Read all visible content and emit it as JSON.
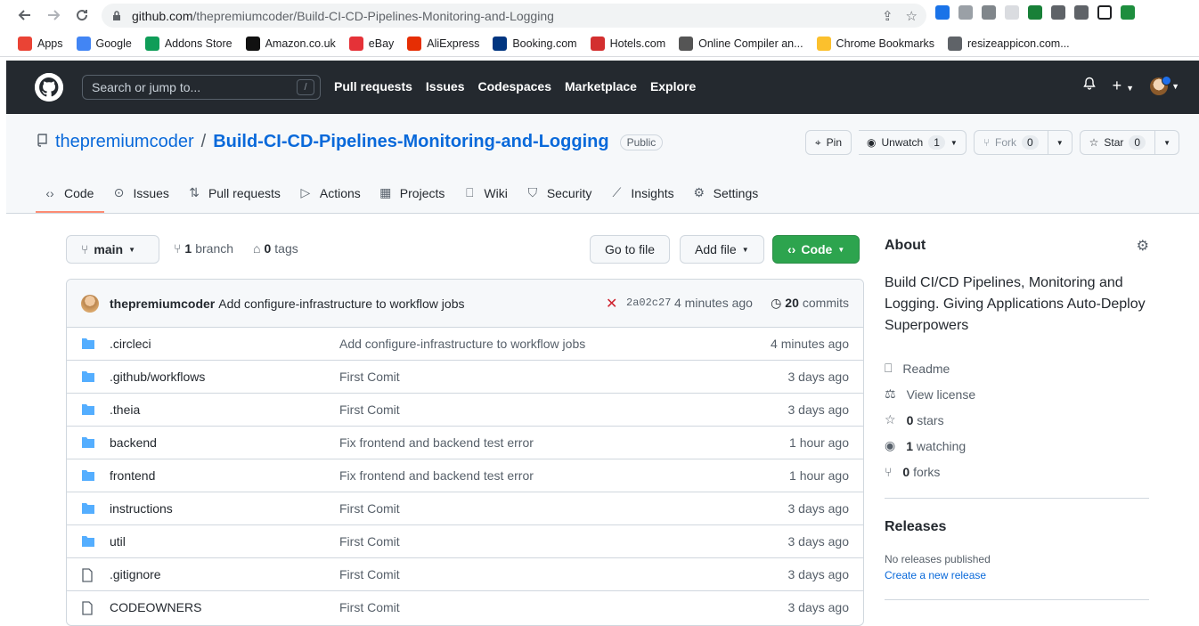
{
  "browser": {
    "url_host": "github.com",
    "url_path": "/thepremiumcoder/Build-CI-CD-Pipelines-Monitoring-and-Logging"
  },
  "bookmarks": [
    {
      "label": "Apps",
      "icon": "apps-grid-icon",
      "color": "#ea4335"
    },
    {
      "label": "Google",
      "icon": "google-icon",
      "color": "#4285f4"
    },
    {
      "label": "Addons Store",
      "icon": "addons-icon",
      "color": "#0f9d58"
    },
    {
      "label": "Amazon.co.uk",
      "icon": "amazon-icon",
      "color": "#111111"
    },
    {
      "label": "eBay",
      "icon": "ebay-icon",
      "color": "#e53238"
    },
    {
      "label": "AliExpress",
      "icon": "aliexpress-icon",
      "color": "#e62e04"
    },
    {
      "label": "Booking.com",
      "icon": "booking-icon",
      "color": "#003580"
    },
    {
      "label": "Hotels.com",
      "icon": "hotels-icon",
      "color": "#d32f2f"
    },
    {
      "label": "Online Compiler an...",
      "icon": "compiler-icon",
      "color": "#555555"
    },
    {
      "label": "Chrome Bookmarks",
      "icon": "folder-icon",
      "color": "#fbc02d"
    },
    {
      "label": "resizeappicon.com...",
      "icon": "globe-icon",
      "color": "#5f6368"
    }
  ],
  "header": {
    "search_placeholder": "Search or jump to...",
    "slash": "/",
    "nav": [
      "Pull requests",
      "Issues",
      "Codespaces",
      "Marketplace",
      "Explore"
    ]
  },
  "repo": {
    "owner": "thepremiumcoder",
    "sep": "/",
    "name": "Build-CI-CD-Pipelines-Monitoring-and-Logging",
    "visibility": "Public",
    "pin": "Pin",
    "unwatch": "Unwatch",
    "watch_count": "1",
    "fork": "Fork",
    "fork_count": "0",
    "star": "Star",
    "star_count": "0"
  },
  "tabs": [
    {
      "label": "Code",
      "icon": "code-icon",
      "glyph": "‹›"
    },
    {
      "label": "Issues",
      "icon": "issue-icon",
      "glyph": "⊙"
    },
    {
      "label": "Pull requests",
      "icon": "pull-request-icon",
      "glyph": "⇅"
    },
    {
      "label": "Actions",
      "icon": "play-icon",
      "glyph": "▷"
    },
    {
      "label": "Projects",
      "icon": "table-icon",
      "glyph": "▦"
    },
    {
      "label": "Wiki",
      "icon": "book-icon",
      "glyph": "⎕"
    },
    {
      "label": "Security",
      "icon": "shield-icon",
      "glyph": "⛉"
    },
    {
      "label": "Insights",
      "icon": "graph-icon",
      "glyph": "⟋"
    },
    {
      "label": "Settings",
      "icon": "gear-icon",
      "glyph": "⚙"
    }
  ],
  "branchbar": {
    "branch": "main",
    "branch_count": "1",
    "branch_word": "branch",
    "tag_count": "0",
    "tag_word": "tags",
    "go_to_file": "Go to file",
    "add_file": "Add file",
    "code": "Code"
  },
  "commit": {
    "author": "thepremiumcoder",
    "message": "Add configure-infrastructure to workflow jobs",
    "sha": "2a02c27",
    "time": "4 minutes ago",
    "count": "20",
    "count_word": "commits"
  },
  "files": [
    {
      "type": "dir",
      "name": ".circleci",
      "message": "Add configure-infrastructure to workflow jobs",
      "age": "4 minutes ago"
    },
    {
      "type": "dir",
      "name": ".github/workflows",
      "message": "First Comit",
      "age": "3 days ago"
    },
    {
      "type": "dir",
      "name": ".theia",
      "message": "First Comit",
      "age": "3 days ago"
    },
    {
      "type": "dir",
      "name": "backend",
      "message": "Fix frontend and backend test error",
      "age": "1 hour ago"
    },
    {
      "type": "dir",
      "name": "frontend",
      "message": "Fix frontend and backend test error",
      "age": "1 hour ago"
    },
    {
      "type": "dir",
      "name": "instructions",
      "message": "First Comit",
      "age": "3 days ago"
    },
    {
      "type": "dir",
      "name": "util",
      "message": "First Comit",
      "age": "3 days ago"
    },
    {
      "type": "file",
      "name": ".gitignore",
      "message": "First Comit",
      "age": "3 days ago"
    },
    {
      "type": "file",
      "name": "CODEOWNERS",
      "message": "First Comit",
      "age": "3 days ago"
    }
  ],
  "about": {
    "title": "About",
    "description": "Build CI/CD Pipelines, Monitoring and Logging. Giving Applications Auto-Deploy Superpowers",
    "readme": "Readme",
    "license": "View license",
    "stars_count": "0",
    "stars_word": "stars",
    "watching_count": "1",
    "watching_word": "watching",
    "forks_count": "0",
    "forks_word": "forks"
  },
  "releases": {
    "title": "Releases",
    "empty": "No releases published",
    "create": "Create a new release"
  },
  "colors": {
    "header_bg": "#24292f",
    "link": "#0969da",
    "green_button": "#2da44e",
    "folder": "#54aeff",
    "tab_underline": "#fd8c73",
    "fail_x": "#cf222e"
  }
}
